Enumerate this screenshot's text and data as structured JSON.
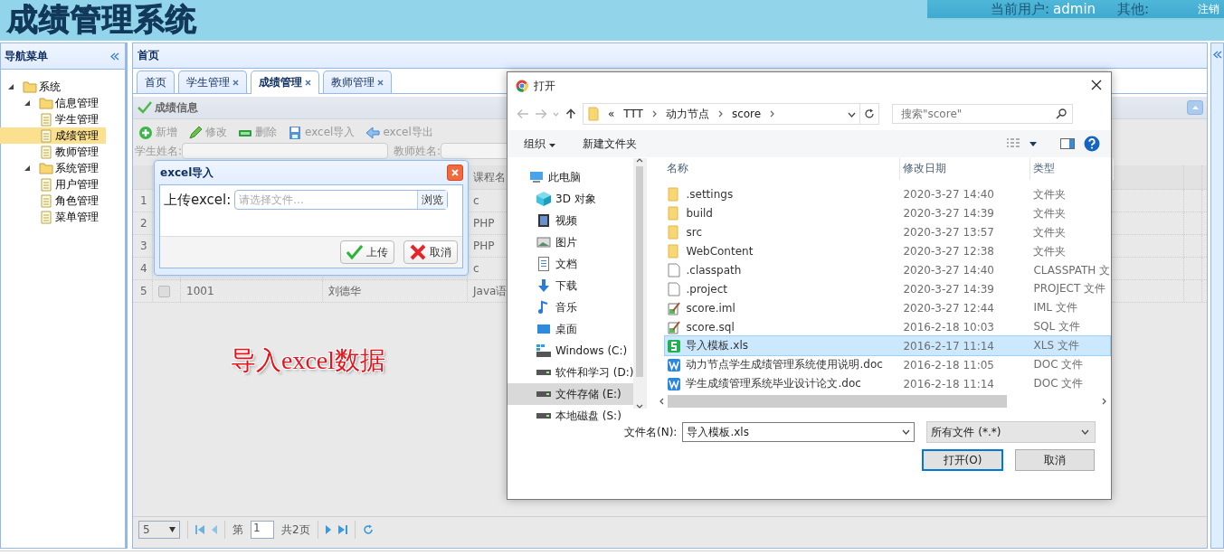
{
  "header": {
    "title": "成绩管理系统",
    "user_label": "当前用户:",
    "user": "admin",
    "other_label": "其他:",
    "logout": "注销"
  },
  "nav": {
    "title": "导航菜单",
    "tree": [
      {
        "label": "系统",
        "expanded": true,
        "children": [
          {
            "label": "信息管理",
            "expanded": true,
            "children": [
              {
                "label": "学生管理",
                "selected": false
              },
              {
                "label": "成绩管理",
                "selected": true
              },
              {
                "label": "教师管理",
                "selected": false
              }
            ]
          },
          {
            "label": "系统管理",
            "expanded": true,
            "children": [
              {
                "label": "用户管理",
                "selected": false
              },
              {
                "label": "角色管理",
                "selected": false
              },
              {
                "label": "菜单管理",
                "selected": false
              }
            ]
          }
        ]
      }
    ]
  },
  "main": {
    "title": "首页",
    "tabs": [
      {
        "label": "首页",
        "closable": false,
        "selected": false
      },
      {
        "label": "学生管理",
        "closable": true,
        "selected": false
      },
      {
        "label": "成绩管理",
        "closable": true,
        "selected": true
      },
      {
        "label": "教师管理",
        "closable": true,
        "selected": false
      }
    ],
    "panel_title": "成绩信息",
    "toolbar": [
      {
        "label": "新增",
        "kind": "add"
      },
      {
        "label": "修改",
        "kind": "edit"
      },
      {
        "label": "删除",
        "kind": "delete"
      },
      {
        "label": "excel导入",
        "kind": "import"
      },
      {
        "label": "excel导出",
        "kind": "export"
      }
    ],
    "filters": [
      {
        "label": "学生姓名:"
      },
      {
        "label": "教师姓名:"
      }
    ],
    "table": {
      "columns": [
        {
          "label": "课程名"
        }
      ],
      "rows": [
        {
          "number": "1",
          "course": "c"
        },
        {
          "number": "2",
          "course": "PHP"
        },
        {
          "number": "3",
          "course": "PHP"
        },
        {
          "number": "4",
          "course": "c"
        },
        {
          "number": "5",
          "checked": false,
          "column_1": "1001",
          "column_2": "刘德华",
          "course": "Java语"
        }
      ]
    },
    "annotation": "导入excel数据",
    "pager": {
      "page_size": "5",
      "page_prefix": "第",
      "page": "1",
      "total": "共2页"
    }
  },
  "excel_dialog": {
    "title": "excel导入",
    "label": "上传excel:",
    "placeholder": "请选择文件...",
    "browse": "浏览",
    "buttons": [
      {
        "label": "上传",
        "kind": "ok"
      },
      {
        "label": "取消",
        "kind": "cancel"
      }
    ]
  },
  "file_dialog": {
    "title": "打开",
    "path_prefix": "«",
    "path": [
      "TTT",
      "动力节点",
      "score"
    ],
    "search_placeholder": "搜索\"score\"",
    "organize": "组织",
    "new_folder": "新建文件夹",
    "sidebar": [
      {
        "label": "此电脑",
        "kind": "pc",
        "selected": false
      },
      {
        "label": "3D 对象",
        "kind": "cube",
        "selected": false
      },
      {
        "label": "视频",
        "kind": "video",
        "selected": false
      },
      {
        "label": "图片",
        "kind": "picture",
        "selected": false
      },
      {
        "label": "文档",
        "kind": "document",
        "selected": false
      },
      {
        "label": "下载",
        "kind": "download",
        "selected": false
      },
      {
        "label": "音乐",
        "kind": "music",
        "selected": false
      },
      {
        "label": "桌面",
        "kind": "desktop",
        "selected": false
      },
      {
        "label": "Windows (C:)",
        "kind": "windrive",
        "selected": false
      },
      {
        "label": "软件和学习 (D:)",
        "kind": "drive",
        "selected": false
      },
      {
        "label": "文件存储 (E:)",
        "kind": "drive",
        "selected": true
      },
      {
        "label": "本地磁盘 (S:)",
        "kind": "drive",
        "selected": false
      }
    ],
    "columns": [
      {
        "label": "名称"
      },
      {
        "label": "修改日期"
      },
      {
        "label": "类型"
      }
    ],
    "files": [
      {
        "name": ".settings",
        "date": "2020-3-27 14:40",
        "type": "文件夹",
        "kind": "folder",
        "selected": false
      },
      {
        "name": "build",
        "date": "2020-3-27 14:39",
        "type": "文件夹",
        "kind": "folder",
        "selected": false
      },
      {
        "name": "src",
        "date": "2020-3-27 13:57",
        "type": "文件夹",
        "kind": "folder",
        "selected": false
      },
      {
        "name": "WebContent",
        "date": "2020-3-27 12:38",
        "type": "文件夹",
        "kind": "folder",
        "selected": false
      },
      {
        "name": ".classpath",
        "date": "2020-3-27 14:40",
        "type": "CLASSPATH 文",
        "kind": "file",
        "selected": false
      },
      {
        "name": ".project",
        "date": "2020-3-27 14:39",
        "type": "PROJECT 文件",
        "kind": "file",
        "selected": false
      },
      {
        "name": "score.iml",
        "date": "2020-3-27 12:44",
        "type": "IML 文件",
        "kind": "text",
        "selected": false
      },
      {
        "name": "score.sql",
        "date": "2016-2-18 10:03",
        "type": "SQL 文件",
        "kind": "text",
        "selected": false
      },
      {
        "name": "导入模板.xls",
        "date": "2016-2-17 11:14",
        "type": "XLS 文件",
        "kind": "sheet",
        "selected": true
      },
      {
        "name": "动力节点学生成绩管理系统使用说明.doc",
        "date": "2016-2-18 11:05",
        "type": "DOC 文件",
        "kind": "doc",
        "selected": false
      },
      {
        "name": "学生成绩管理系统毕业设计论文.doc",
        "date": "2016-2-18 11:14",
        "type": "DOC 文件",
        "kind": "doc",
        "selected": false
      }
    ],
    "filename_label": "文件名(N):",
    "filename": "导入模板.xls",
    "filter": "所有文件 (*.*)",
    "buttons": [
      {
        "label": "打开(O)",
        "primary": true
      },
      {
        "label": "取消",
        "primary": false
      }
    ]
  }
}
